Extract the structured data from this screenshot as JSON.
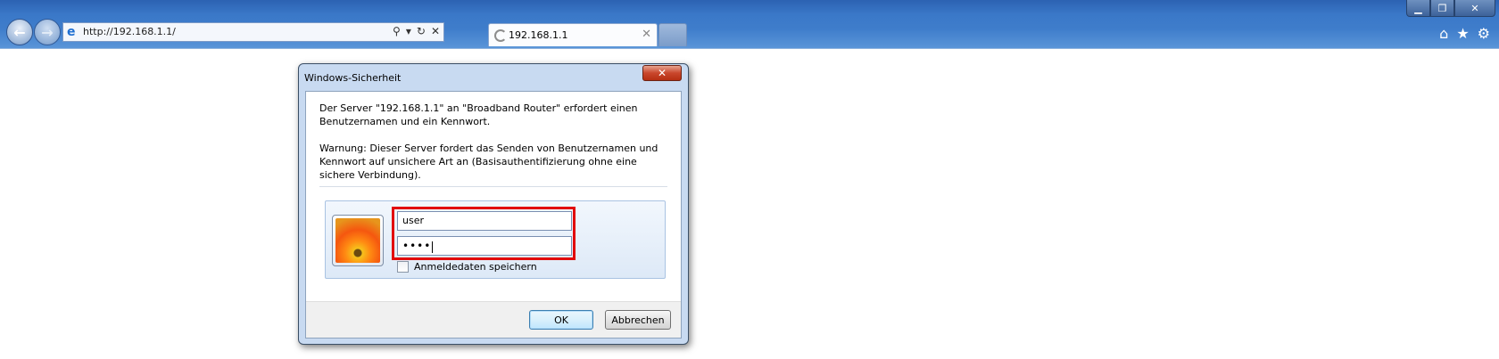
{
  "browser": {
    "address": "http://192.168.1.1/",
    "tab_title": "192.168.1.1",
    "window_controls": {
      "minimize": "▁",
      "maximize": "❐",
      "close": "✕"
    },
    "right_icons": [
      "home-icon",
      "favorites-star-icon",
      "gear-icon"
    ]
  },
  "dialog": {
    "title": "Windows-Sicherheit",
    "message": "Der Server \"192.168.1.1\" an \"Broadband Router\" erfordert einen Benutzernamen und ein Kennwort.",
    "warning": "Warnung: Dieser Server fordert das Senden von Benutzernamen und Kennwort auf unsichere Art an (Basisauthentifizierung ohne eine sichere Verbindung).",
    "username_value": "user",
    "password_value": "••••",
    "remember_label": "Anmeldedaten speichern",
    "remember_checked": false,
    "ok_label": "OK",
    "cancel_label": "Abbrechen",
    "close_glyph": "✕"
  },
  "colors": {
    "titlebar": "#3f7dcb",
    "highlight_box": "#e20a0a",
    "dialog_frame": "#c8daf1"
  }
}
